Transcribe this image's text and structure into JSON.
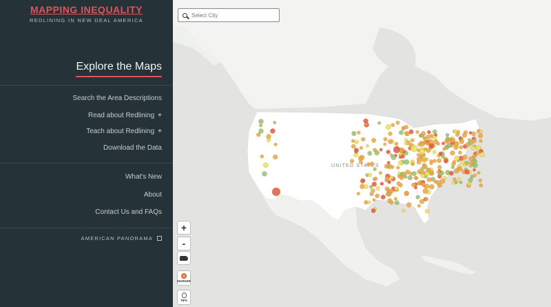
{
  "brand": {
    "title": "MAPPING INEQUALITY",
    "subtitle": "REDLINING IN NEW DEAL AMERICA"
  },
  "explore": {
    "title": "Explore the Maps"
  },
  "nav": {
    "primary": [
      {
        "label": "Search the Area Descriptions"
      },
      {
        "label": "Read about Redlining",
        "plus": "+"
      },
      {
        "label": "Teach about Redlining",
        "plus": "+"
      },
      {
        "label": "Download the Data"
      }
    ],
    "secondary": [
      {
        "label": "What's New"
      },
      {
        "label": "About"
      },
      {
        "label": "Contact Us and FAQs"
      }
    ],
    "panorama": "AMERICAN PANORAMA"
  },
  "search": {
    "placeholder": "Select City"
  },
  "map": {
    "country_label": "UNITED STATES"
  },
  "controls": {
    "zoom_in": "+",
    "zoom_out": "-",
    "marker_label": "MARKER",
    "tips_label": "TIPS"
  },
  "colors": {
    "accent": "#e0545c",
    "sidebar_bg": "#253237",
    "land": "#ffffff",
    "water": "#e3e3e1",
    "marker_orange": "#e8a64a",
    "marker_yellow": "#e6e45a",
    "marker_green": "#8fc27a",
    "marker_red": "#e05a4a"
  }
}
